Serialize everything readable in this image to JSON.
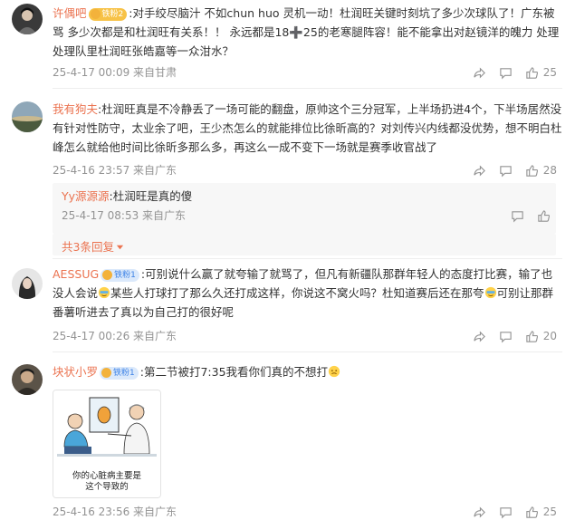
{
  "comments": [
    {
      "user": "许偶吧",
      "badge": "铁粉2",
      "text": ":对手绞尽脑汁 不如chun huo 灵机一动！杜润旺关键时刻坑了多少次球队了！广东被骂 多少次都是和杜润旺有关系！！ 永远都是18➕25的老寒腿阵容！能不能拿出对赵镜洋的魄力 处理处理队里杜润旺张皓嘉等一众泔水？",
      "meta": "25-4-17 00:09 来自甘肃",
      "likes": "25"
    },
    {
      "user": "我有狗夫",
      "text": ":杜润旺真是不冷静丢了一场可能的翻盘，原帅这个三分冠军，上半场扔进4个，下半场居然没有针对性防守，太业余了吧，王少杰怎么的就能排位比徐昕高的？对刘传兴内线都没优势，想不明白杜峰怎么就给他时间比徐昕多那么多，再这么一成不变下一场就是赛季收官战了",
      "meta": "25-4-16 23:57 来自广东",
      "likes": "28",
      "reply": {
        "user": "Yy源源源",
        "text": ":杜润旺是真的傻",
        "meta": "25-4-17 08:53 来自广东"
      },
      "more_replies": "共3条回复"
    },
    {
      "user": "AESSUG",
      "badge": "铁粉1",
      "text_parts": [
        ":可别说什么赢了就夸输了就骂了，但凡有新疆队那群年轻人的态度打比赛，输了也没人会说",
        "某些人打球打了那么久还打成这样，你说这不窝火吗？杜知道赛后还在那夸",
        "可别让那群番薯听进去了真以为自己打的很好呢"
      ],
      "meta": "25-4-17 00:26 来自广东",
      "likes": "20"
    },
    {
      "user": "块状小罗",
      "badge": "铁粉1",
      "text": ":第二节被打7:35我看你们真的不想打",
      "meta": "25-4-16 23:56 来自广东",
      "likes": "25",
      "sticker_caption_1": "你的心脏病主要是",
      "sticker_caption_2": "这个导致的"
    }
  ],
  "colors": {
    "username": "#eb7350",
    "meta": "#939393",
    "reply_bg": "#f7f7f7"
  },
  "icons": [
    "share-icon",
    "comment-icon",
    "like-icon",
    "chevron-down-icon"
  ]
}
